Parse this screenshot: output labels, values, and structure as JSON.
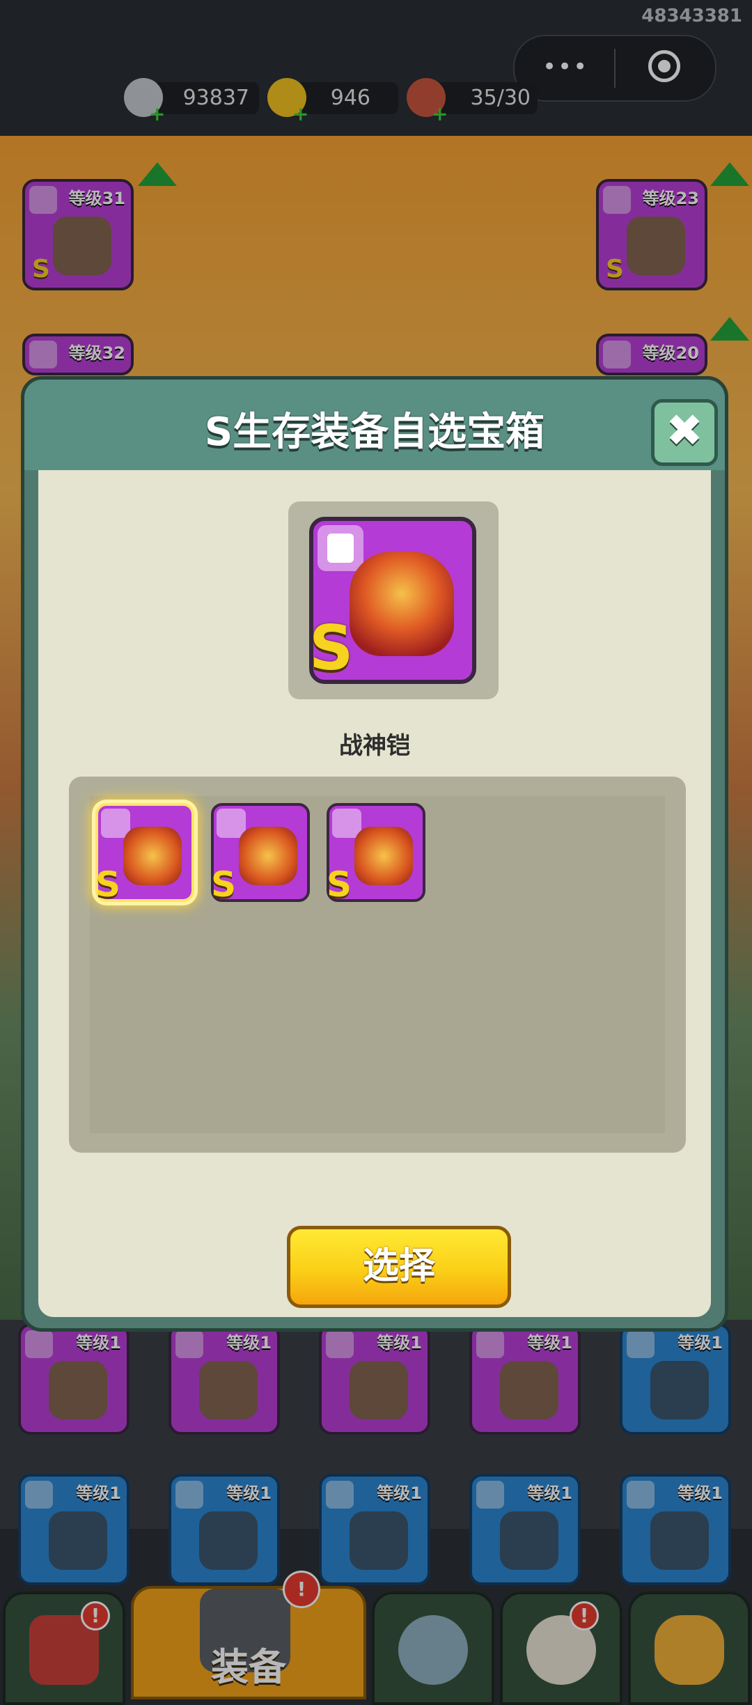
{
  "status": {
    "user_id": "48343381"
  },
  "miniprogram_capsule": {
    "more": "•••"
  },
  "resources": [
    {
      "name": "silver-coin",
      "value": "93837",
      "color": "#c5c9cf"
    },
    {
      "name": "gold-ingot",
      "value": "946",
      "color": "#f2c321"
    },
    {
      "name": "meat-stamina",
      "value": "35/30",
      "color": "#c9553f"
    }
  ],
  "equipped_left": [
    {
      "level": "等级31",
      "grade": "S"
    },
    {
      "level": "等级32"
    }
  ],
  "equipped_right": [
    {
      "level": "等级23",
      "grade": "S"
    },
    {
      "level": "等级20"
    }
  ],
  "inventory_row1": [
    {
      "level": "等级1",
      "rarity": "purple"
    },
    {
      "level": "等级1",
      "rarity": "purple"
    },
    {
      "level": "等级1",
      "rarity": "purple"
    },
    {
      "level": "等级1",
      "rarity": "purple"
    },
    {
      "level": "等级1",
      "rarity": "blue"
    }
  ],
  "inventory_row2": [
    {
      "level": "等级1",
      "rarity": "blue"
    },
    {
      "level": "等级1",
      "rarity": "blue"
    },
    {
      "level": "等级1",
      "rarity": "blue"
    },
    {
      "level": "等级1",
      "rarity": "blue"
    },
    {
      "level": "等级1",
      "rarity": "blue"
    }
  ],
  "bottom_nav": {
    "active_label": "装备",
    "badge": "!"
  },
  "modal": {
    "title": "S生存装备自选宝箱",
    "close": "✖",
    "preview": {
      "grade": "S",
      "name": "战神铠"
    },
    "options": [
      {
        "grade": "S",
        "selected": true
      },
      {
        "grade": "S",
        "selected": false
      },
      {
        "grade": "S",
        "selected": false
      }
    ],
    "select_button": "选择"
  },
  "colors": {
    "modal_header": "#5a8f84",
    "panel": "#e4e4d0",
    "purple_card": "#b43bd6",
    "blue_card": "#2c86d0",
    "select_button": "#fbcf17"
  }
}
